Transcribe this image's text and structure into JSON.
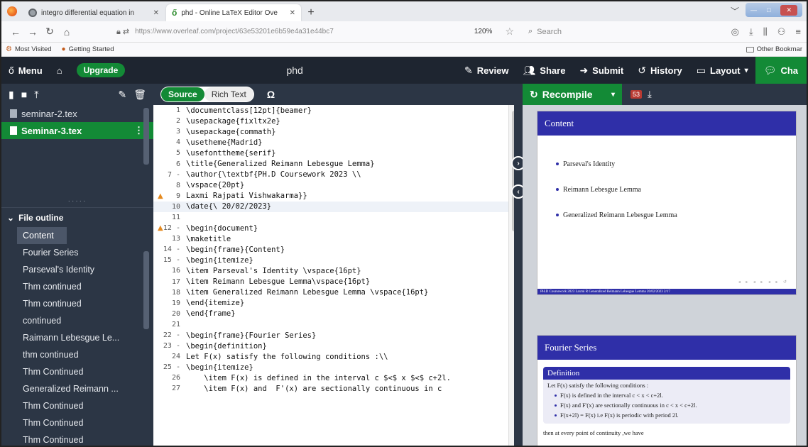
{
  "browser": {
    "tabs": [
      {
        "title": "integro differential equation in",
        "close": "✕"
      },
      {
        "title": "phd - Online LaTeX Editor Ove",
        "close": "✕"
      }
    ],
    "new_tab": "+",
    "url": "https://www.overleaf.com/project/63e53201e6b59e4a31e44bc7",
    "zoom": "120%",
    "search_placeholder": "Search",
    "bookmarks": [
      "Most Visited",
      "Getting Started"
    ],
    "other_bookmarks": "Other Bookmar"
  },
  "toolbar": {
    "menu": "Menu",
    "upgrade": "Upgrade",
    "project_title": "phd",
    "review": "Review",
    "share": "Share",
    "submit": "Submit",
    "history": "History",
    "layout": "Layout",
    "chat": "Cha"
  },
  "files": [
    {
      "name": "seminar-2.tex"
    },
    {
      "name": "Seminar-3.tex"
    }
  ],
  "file_outline": {
    "heading": "File outline",
    "items": [
      "Content",
      "Fourier Series",
      "Parseval's Identity",
      "Thm continued",
      "Thm continued",
      "continued",
      "Raimann Lebesgue Le...",
      "thm continued",
      "Thm Continued",
      "Generalized Reimann ...",
      "Thm Continued",
      "Thm Continued",
      "Thm Continued"
    ]
  },
  "editor": {
    "source": "Source",
    "rich_text": "Rich Text",
    "omega": "Ω",
    "lines": [
      {
        "n": "1",
        "text": "\\documentclass[12pt]{beamer}"
      },
      {
        "n": "2",
        "text": "\\usepackage{fixltx2e}"
      },
      {
        "n": "3",
        "text": "\\usepackage{commath}"
      },
      {
        "n": "4",
        "text": "\\usetheme{Madrid}"
      },
      {
        "n": "5",
        "text": "\\usefonttheme{serif}"
      },
      {
        "n": "6",
        "text": "\\title{Generalized Reimann Lebesgue Lemma}"
      },
      {
        "n": "7 -",
        "text": "\\author{\\textbf{PH.D Coursework 2023 \\\\"
      },
      {
        "n": "8",
        "text": "\\vspace{20pt}"
      },
      {
        "n": "9",
        "text": "Laxmi Rajpati Vishwakarma}}"
      },
      {
        "n": "10",
        "text": "\\date{\\ 20/02/2023}"
      },
      {
        "n": "11",
        "text": ""
      },
      {
        "n": "12 -",
        "text": "\\begin{document}"
      },
      {
        "n": "13",
        "text": "\\maketitle"
      },
      {
        "n": "14 -",
        "text": "\\begin{frame}{Content}"
      },
      {
        "n": "15 -",
        "text": "\\begin{itemize}"
      },
      {
        "n": "16",
        "text": "\\item Parseval's Identity \\vspace{16pt}"
      },
      {
        "n": "17",
        "text": "\\item Reimann Lebesgue Lemma\\vspace{16pt}"
      },
      {
        "n": "18",
        "text": "\\item Generalized Reimann Lebesgue Lemma \\vspace{16pt}"
      },
      {
        "n": "19",
        "text": "\\end{itemize}"
      },
      {
        "n": "20",
        "text": "\\end{frame}"
      },
      {
        "n": "21",
        "text": ""
      },
      {
        "n": "22 -",
        "text": "\\begin{frame}{Fourier Series}"
      },
      {
        "n": "23 -",
        "text": "\\begin{definition}"
      },
      {
        "n": "24",
        "text": "Let F(x) satisfy the following conditions :\\\\"
      },
      {
        "n": "25 -",
        "text": "\\begin{itemize}"
      },
      {
        "n": "26",
        "text": "    \\item F(x) is defined in the interval c $<$ x $<$ c+2l."
      },
      {
        "n": "27",
        "text": "    \\item F(x) and  F'(x) are sectionally continuous in c"
      }
    ]
  },
  "pdf": {
    "recompile": "Recompile",
    "badge": "53",
    "slide1": {
      "title": "Content",
      "bullets": [
        "Parseval's Identity",
        "Reimann Lebesgue Lemma",
        "Generalized Reimann Lebesgue Lemma"
      ],
      "footer": "PH.D Coursework 2023   Laxmi R Generalized Reimann Lebesgue Lemma   20/02/2023   2/17"
    },
    "slide2": {
      "title": "Fourier Series",
      "def_title": "Definition",
      "def_intro": "Let F(x) satisfy the following conditions :",
      "items": [
        "F(x) is defined in the interval c < x < c+2l.",
        "F(x) and F'(x) are sectionally continuous in c < x < c+2l.",
        "F(x+2l) = F(x) i.e F(x) is periodic with period 2l."
      ],
      "after": "then at every point of continuity ,we have"
    }
  }
}
